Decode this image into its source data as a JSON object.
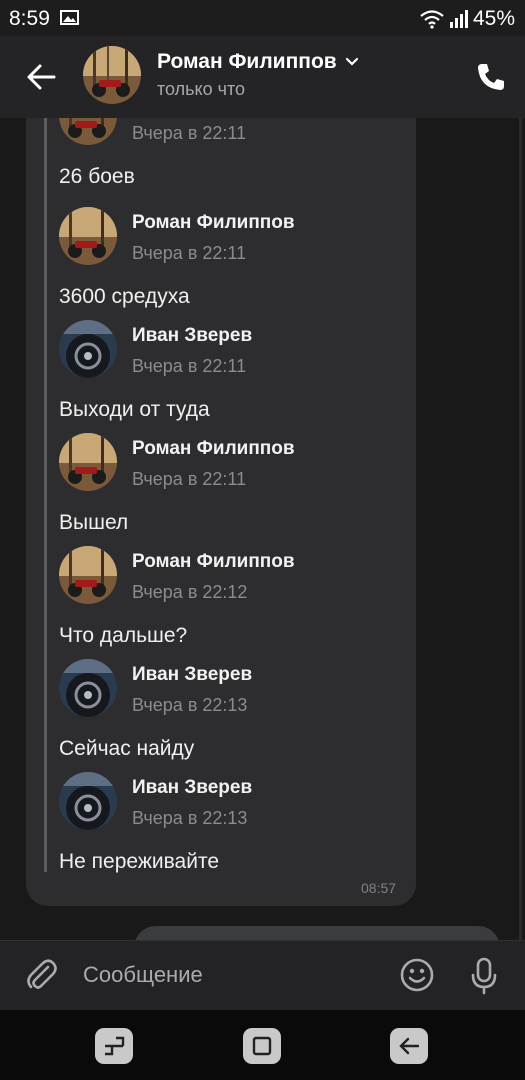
{
  "status_bar": {
    "time": "8:59",
    "battery": "45%"
  },
  "header": {
    "contact_name": "Роман Филиппов",
    "status": "только что"
  },
  "forwarded": [
    {
      "author": "",
      "date": "Вчера в 22:11",
      "text": "26 боев",
      "avatar": "moto"
    },
    {
      "author": "Роман Филиппов",
      "date": "Вчера в 22:11",
      "text": "3600 средуха",
      "avatar": "moto"
    },
    {
      "author": "Иван Зверев",
      "date": "Вчера в 22:11",
      "text": "Выходи от туда",
      "avatar": "car"
    },
    {
      "author": "Роман Филиппов",
      "date": "Вчера в 22:11",
      "text": "Вышел",
      "avatar": "moto"
    },
    {
      "author": "Роман Филиппов",
      "date": "Вчера в 22:12",
      "text": "Что дальше?",
      "avatar": "moto"
    },
    {
      "author": "Иван Зверев",
      "date": "Вчера в 22:13",
      "text": "Сейчас найду",
      "avatar": "car"
    },
    {
      "author": "Иван Зверев",
      "date": "Вчера в 22:13",
      "text": "Не переживайте",
      "avatar": "car"
    }
  ],
  "bubble_time": "08:57",
  "composer": {
    "placeholder": "Сообщение"
  },
  "icons": {
    "back": "arrow-left-icon",
    "call": "phone-icon",
    "attach": "paperclip-icon",
    "emoji": "smile-icon",
    "voice": "microphone-icon",
    "nav_recent": "recent-apps-icon",
    "nav_home": "home-icon",
    "nav_back": "back-icon"
  },
  "colors": {
    "background": "#19191a",
    "bubble": "#2d2d2f",
    "header": "#242426",
    "accent_text": "#ffffff",
    "muted_text": "#8a8c91"
  }
}
